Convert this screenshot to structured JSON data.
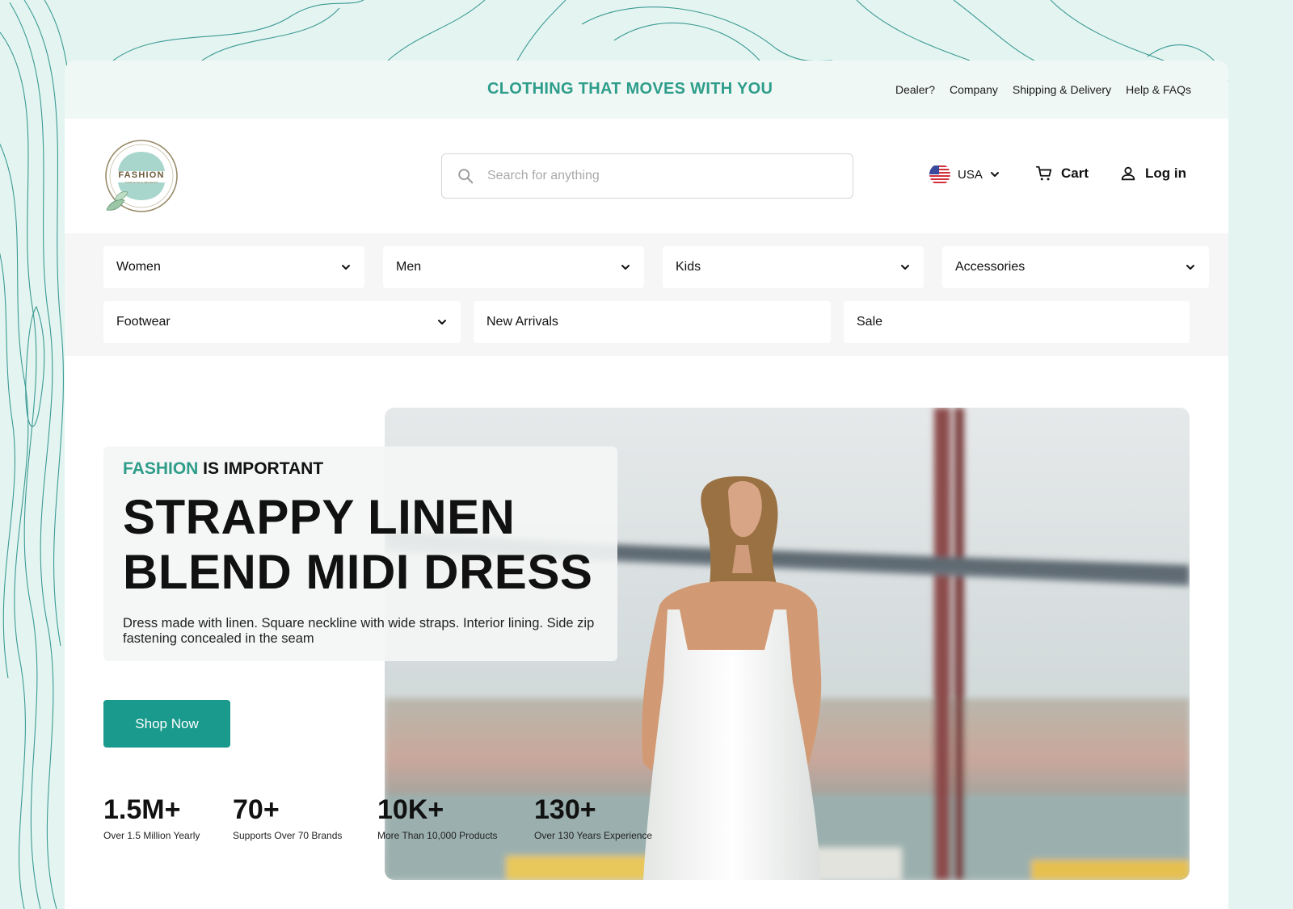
{
  "announcement": "CLOTHING THAT MOVES WITH YOU",
  "top_links": [
    "Dealer?",
    "Company",
    "Shipping & Delivery",
    "Help & FAQs"
  ],
  "logo": {
    "text": "FASHION",
    "subtext": "YOUR STYLE IS IMPORTANT"
  },
  "search": {
    "placeholder": "Search for anything",
    "value": ""
  },
  "country": {
    "label": "USA",
    "flag": "us-flag-icon"
  },
  "cart_label": "Cart",
  "login_label": "Log in",
  "categories": [
    {
      "label": "Women",
      "has_dropdown": true
    },
    {
      "label": "Men",
      "has_dropdown": true
    },
    {
      "label": "Kids",
      "has_dropdown": true
    },
    {
      "label": "Accessories",
      "has_dropdown": true
    },
    {
      "label": "Footwear",
      "has_dropdown": true
    },
    {
      "label": "New Arrivals",
      "has_dropdown": false
    },
    {
      "label": "Sale",
      "has_dropdown": false
    }
  ],
  "hero": {
    "tagline_accent": "FASHION",
    "tagline_rest": " IS IMPORTANT",
    "title_line1": "STRAPPY LINEN",
    "title_line2": "BLEND MIDI DRESS",
    "description": "Dress made with linen. Square neckline with wide straps. Interior lining. Side zip fastening concealed in the seam",
    "cta": "Shop Now"
  },
  "stats": [
    {
      "value": "1.5M+",
      "label": "Over 1.5 Million Yearly"
    },
    {
      "value": "70+",
      "label": "Supports Over 70 Brands"
    },
    {
      "value": "10K+",
      "label": "More Than 10,000 Products"
    },
    {
      "value": "130+",
      "label": "Over 130 Years Experience"
    }
  ],
  "colors": {
    "accent": "#2e9d8a",
    "button": "#1a9a8d",
    "background": "#e4f5f1",
    "topo_lines": "#1f8a83"
  }
}
